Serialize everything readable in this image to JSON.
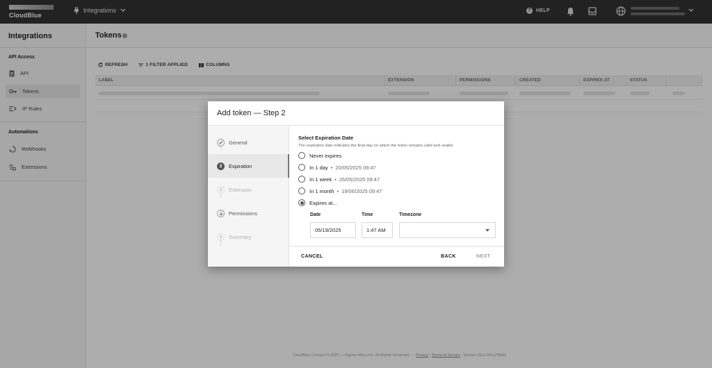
{
  "topbar": {
    "brand": "CloudBlue",
    "app_name": "Integrations",
    "help_label": "HELP",
    "icons": [
      "plug-icon",
      "chevron-down-icon",
      "help-icon",
      "bell-icon",
      "inbox-icon",
      "globe-icon",
      "chevron-down-icon"
    ]
  },
  "sidebar": {
    "title": "Integrations",
    "sections": [
      {
        "label": "API Access",
        "items": [
          {
            "label": "API",
            "icon": "document-icon"
          },
          {
            "label": "Tokens",
            "icon": "key-icon",
            "active": true
          },
          {
            "label": "IP Rules",
            "icon": "ip-rules-icon"
          }
        ]
      },
      {
        "label": "Automations",
        "items": [
          {
            "label": "Webhooks",
            "icon": "webhook-icon"
          },
          {
            "label": "Extensions",
            "icon": "extensions-icon"
          }
        ]
      }
    ]
  },
  "page": {
    "title": "Tokens",
    "toolbar": {
      "refresh": "REFRESH",
      "filter": "1 FILTER APPLIED",
      "columns": "COLUMNS"
    },
    "table": {
      "columns": [
        "LABEL",
        "EXTENSION",
        "PERMISSIONS",
        "CREATED",
        "EXPIRES AT",
        "STATUS"
      ]
    }
  },
  "dialog": {
    "title": "Add token — Step 2",
    "steps": [
      {
        "label": "General",
        "state": "done"
      },
      {
        "label": "Expiration",
        "number": "2",
        "state": "active"
      },
      {
        "label": "Extension",
        "number": "3",
        "state": "disabled"
      },
      {
        "label": "Permissions",
        "state": "done"
      },
      {
        "label": "Summary",
        "number": "5",
        "state": "disabled"
      }
    ],
    "form": {
      "title": "Select Expiration Date",
      "description": "The expiration date indicates the final day on which the token remains valid and usable",
      "options": [
        {
          "label": "Never expires",
          "date": ""
        },
        {
          "label": "In 1 day",
          "date": "20/05/2025 09:47"
        },
        {
          "label": "In 1 week",
          "date": "26/05/2025 09:47"
        },
        {
          "label": "In 1 month",
          "date": "19/06/2025 09:47"
        },
        {
          "label": "Expires at...",
          "date": "",
          "selected": true
        }
      ],
      "date_label": "Date",
      "date_value": "05/19/2025",
      "time_label": "Time",
      "time_value": "1:47 AM",
      "timezone_label": "Timezone",
      "timezone_value": ""
    },
    "buttons": {
      "cancel": "CANCEL",
      "back": "BACK",
      "next": "NEXT"
    }
  },
  "footer": {
    "copyright": "CloudBlue Connect © 2025 — Ingram Micro Inc. All Rights Reserved. —",
    "privacy": "Privacy",
    "terms": "Terms of Service",
    "version": "· Version 36.0.243-g7f6df3"
  }
}
